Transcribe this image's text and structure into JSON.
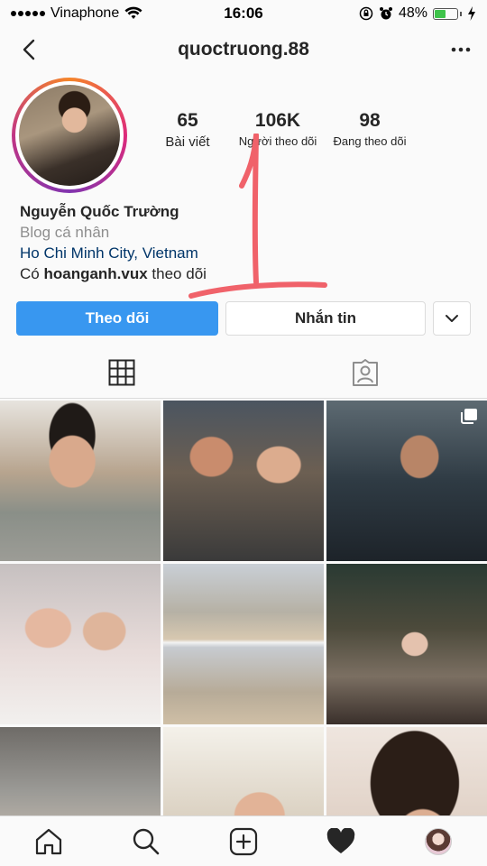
{
  "status_bar": {
    "carrier": "Vinaphone",
    "time": "16:06",
    "battery": "48%",
    "battery_level": 0.48
  },
  "header": {
    "username": "quoctruong.88"
  },
  "stats": {
    "posts_value": "65",
    "posts_label": "Bài viết",
    "followers_value": "106K",
    "followers_label": "Người theo dõi",
    "following_value": "98",
    "following_label": "Đang theo dõi"
  },
  "bio": {
    "name": "Nguyễn Quốc Trường",
    "category": "Blog cá nhân",
    "location": "Ho Chi Minh City, Vietnam",
    "followed_by_prefix": "Có ",
    "followed_by_user": "hoanganh.vux",
    "followed_by_suffix": " theo dõi"
  },
  "actions": {
    "follow_label": "Theo dõi",
    "message_label": "Nhắn tin"
  },
  "tabs": [
    "grid-icon",
    "tagged-icon"
  ],
  "grid_posts": 9,
  "bottom_nav": [
    "home-icon",
    "search-icon",
    "add-post-icon",
    "activity-heart-icon",
    "profile-avatar"
  ],
  "colors": {
    "accent": "#3897f0",
    "location_link": "#003569",
    "annotation": "#f0626a"
  }
}
